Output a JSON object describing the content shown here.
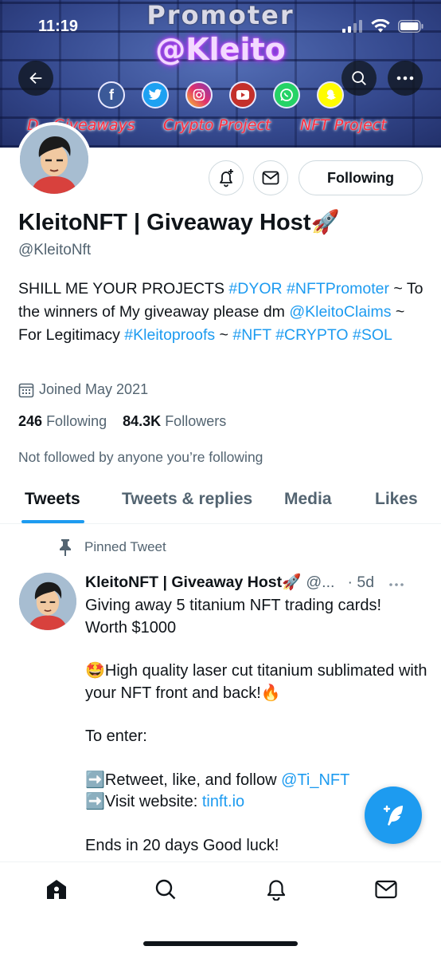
{
  "status_bar": {
    "time": "11:19"
  },
  "banner": {
    "title": "Promoter",
    "tag": "@Kleito",
    "labels": [
      "Giveaways",
      "Crypto Project",
      "NFT Project"
    ],
    "label_prefix": "D",
    "social_icons": [
      "facebook-icon",
      "twitter-icon",
      "instagram-icon",
      "youtube-icon",
      "whatsapp-icon",
      "snapchat-icon"
    ]
  },
  "profile": {
    "following_button": "Following",
    "display_name": "KleitoNFT | Giveaway Host🚀",
    "handle": "@KleitoNft",
    "bio": {
      "p1": "SHILL ME YOUR PROJECTS ",
      "tag1": "#DYOR",
      "tag2": "#NFTPromoter",
      "p2": " ~ To the winners of My giveaway please dm ",
      "mention": "@KleitoClaims",
      "p3": " ~ For Legitimacy ",
      "tag3": "#Kleitoproofs",
      "p4": " ~ ",
      "tag4": "#NFT",
      "tag5": "#CRYPTO",
      "tag6": "#SOL"
    },
    "joined": "Joined May 2021",
    "following_count": "246",
    "following_label": "Following",
    "followers_count": "84.3K",
    "followers_label": "Followers",
    "not_followed": "Not followed by anyone you’re following"
  },
  "tabs": [
    "Tweets",
    "Tweets & replies",
    "Media",
    "Likes"
  ],
  "pinned_tweet": {
    "pinned_label": "Pinned Tweet",
    "author": "KleitoNFT | Giveaway Host🚀",
    "handle": "@...",
    "time": "· 5d",
    "line1": "Giving away 5 titanium NFT trading cards! Worth $1000",
    "line2": "🤩High quality laser cut titanium sublimated with your NFT front and back!🔥",
    "line3": "To enter:",
    "line4_prefix": "➡️Retweet, like, and follow ",
    "line4_mention": "@Ti_NFT",
    "line5_prefix": "➡️Visit website: ",
    "line5_link": "tinft.io",
    "line6": "Ends in 20 days Good luck!"
  },
  "colors": {
    "accent": "#1d9bf0",
    "text": "#0f1419",
    "muted": "#536471"
  }
}
